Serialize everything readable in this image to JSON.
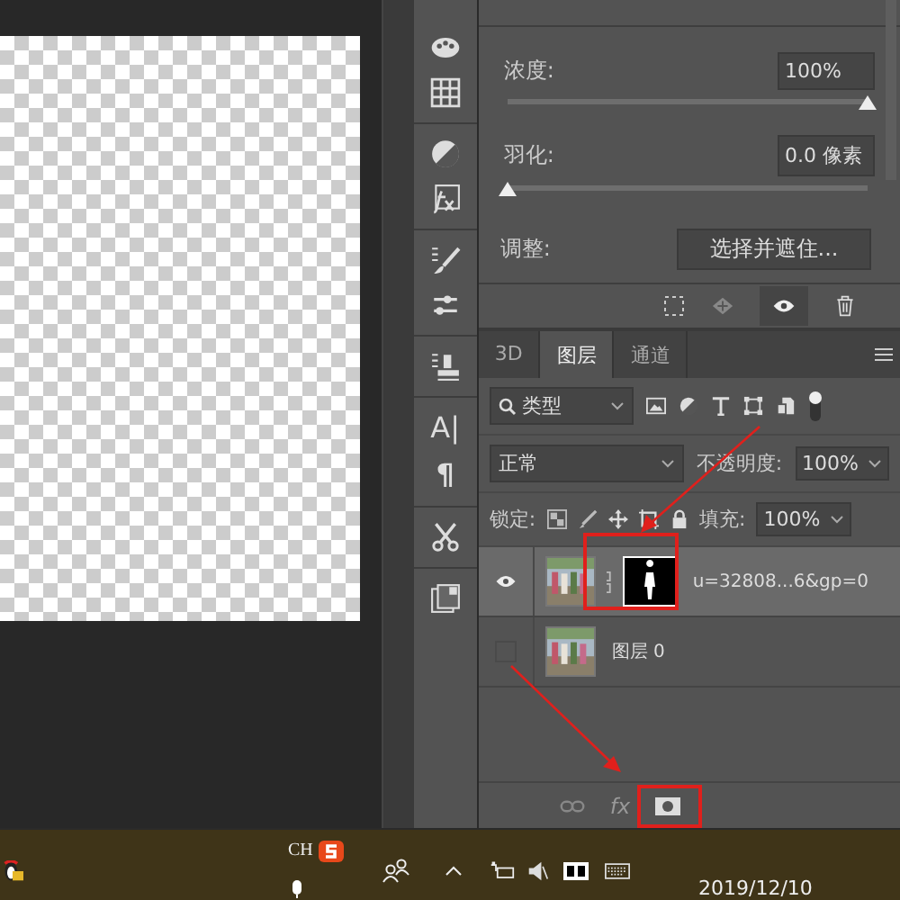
{
  "properties": {
    "density": {
      "label": "浓度:",
      "value": "100%",
      "level": 1
    },
    "feather": {
      "label": "羽化:",
      "value": "0.0 像素",
      "level": 0
    },
    "adjust": {
      "label": "调整:",
      "button": "选择并遮住..."
    }
  },
  "toolbar_glyphs": [
    "A|",
    "¶"
  ],
  "layers_panel": {
    "tabs": [
      {
        "label": "3D",
        "selected": false
      },
      {
        "label": "图层",
        "selected": true
      },
      {
        "label": "通道",
        "selected": false
      }
    ],
    "filter": "类型",
    "blend_mode": "正常",
    "opacity": {
      "label": "不透明度:",
      "value": "100%"
    },
    "lock_label": "锁定:",
    "fill": {
      "label": "填充:",
      "value": "100%"
    },
    "layers": [
      {
        "name": "u=32808...6&gp=0",
        "visible": true,
        "selected": true,
        "has_mask": true
      },
      {
        "name": "图层 0",
        "visible": false,
        "selected": false,
        "has_mask": false
      }
    ],
    "footer_fx": "fx"
  },
  "taskbar": {
    "ime": "CH",
    "date": "2019/12/10"
  }
}
